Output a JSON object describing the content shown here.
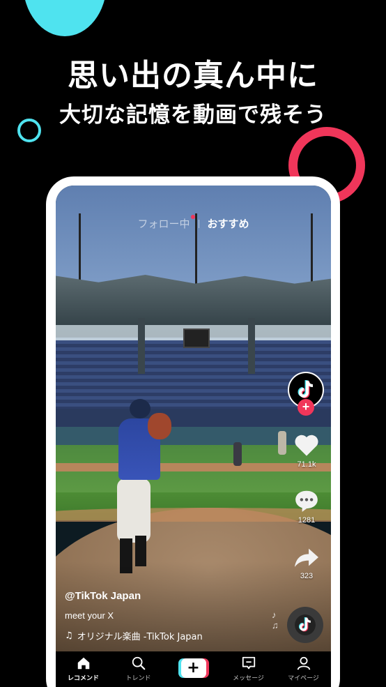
{
  "promo": {
    "headline": "思い出の真ん中に",
    "subheadline": "大切な記憶を動画で残そう"
  },
  "colors": {
    "cyan": "#4fe3ef",
    "pink": "#f0365a"
  },
  "feed": {
    "tabs": {
      "following": "フォロー中",
      "for_you": "おすすめ"
    },
    "actions": {
      "like_count": "71.1k",
      "comment_count": "1281",
      "share_count": "323"
    },
    "caption": {
      "author": "@TikTok Japan",
      "description": "meet your X",
      "sound": "オリジナル楽曲 -TikTok Japan"
    }
  },
  "nav": {
    "home": "レコメンド",
    "discover": "トレンド",
    "create": "+",
    "inbox": "メッセージ",
    "profile": "マイページ"
  },
  "icons": [
    "tiktok-logo-icon",
    "plus-icon",
    "heart-icon",
    "comment-icon",
    "share-icon",
    "music-note-icon",
    "home-icon",
    "search-icon",
    "message-icon",
    "profile-icon"
  ]
}
